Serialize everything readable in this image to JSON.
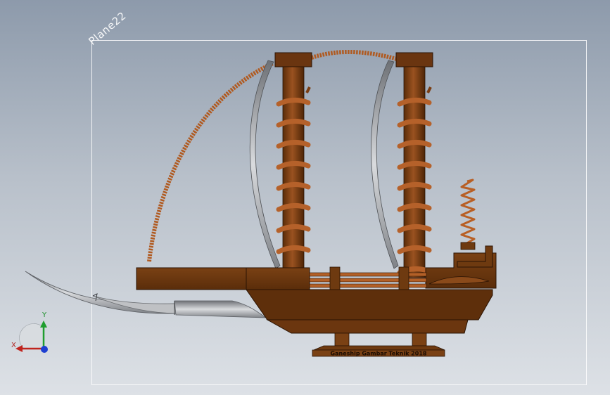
{
  "viewport": {
    "plane_label": "Plane22",
    "plate_text": "Ganeship Gambar Teknik 2018"
  },
  "triad": {
    "x_label": "X",
    "y_label": "Y"
  },
  "colors": {
    "body": "#6e3a10",
    "body_dark": "#4a2407",
    "copper": "#c0652a",
    "coil": "#a04f1c",
    "steel": "#a9acb0",
    "axis_x": "#c0231d",
    "axis_y": "#1f9d2e",
    "axis_z": "#1d3fd1"
  }
}
